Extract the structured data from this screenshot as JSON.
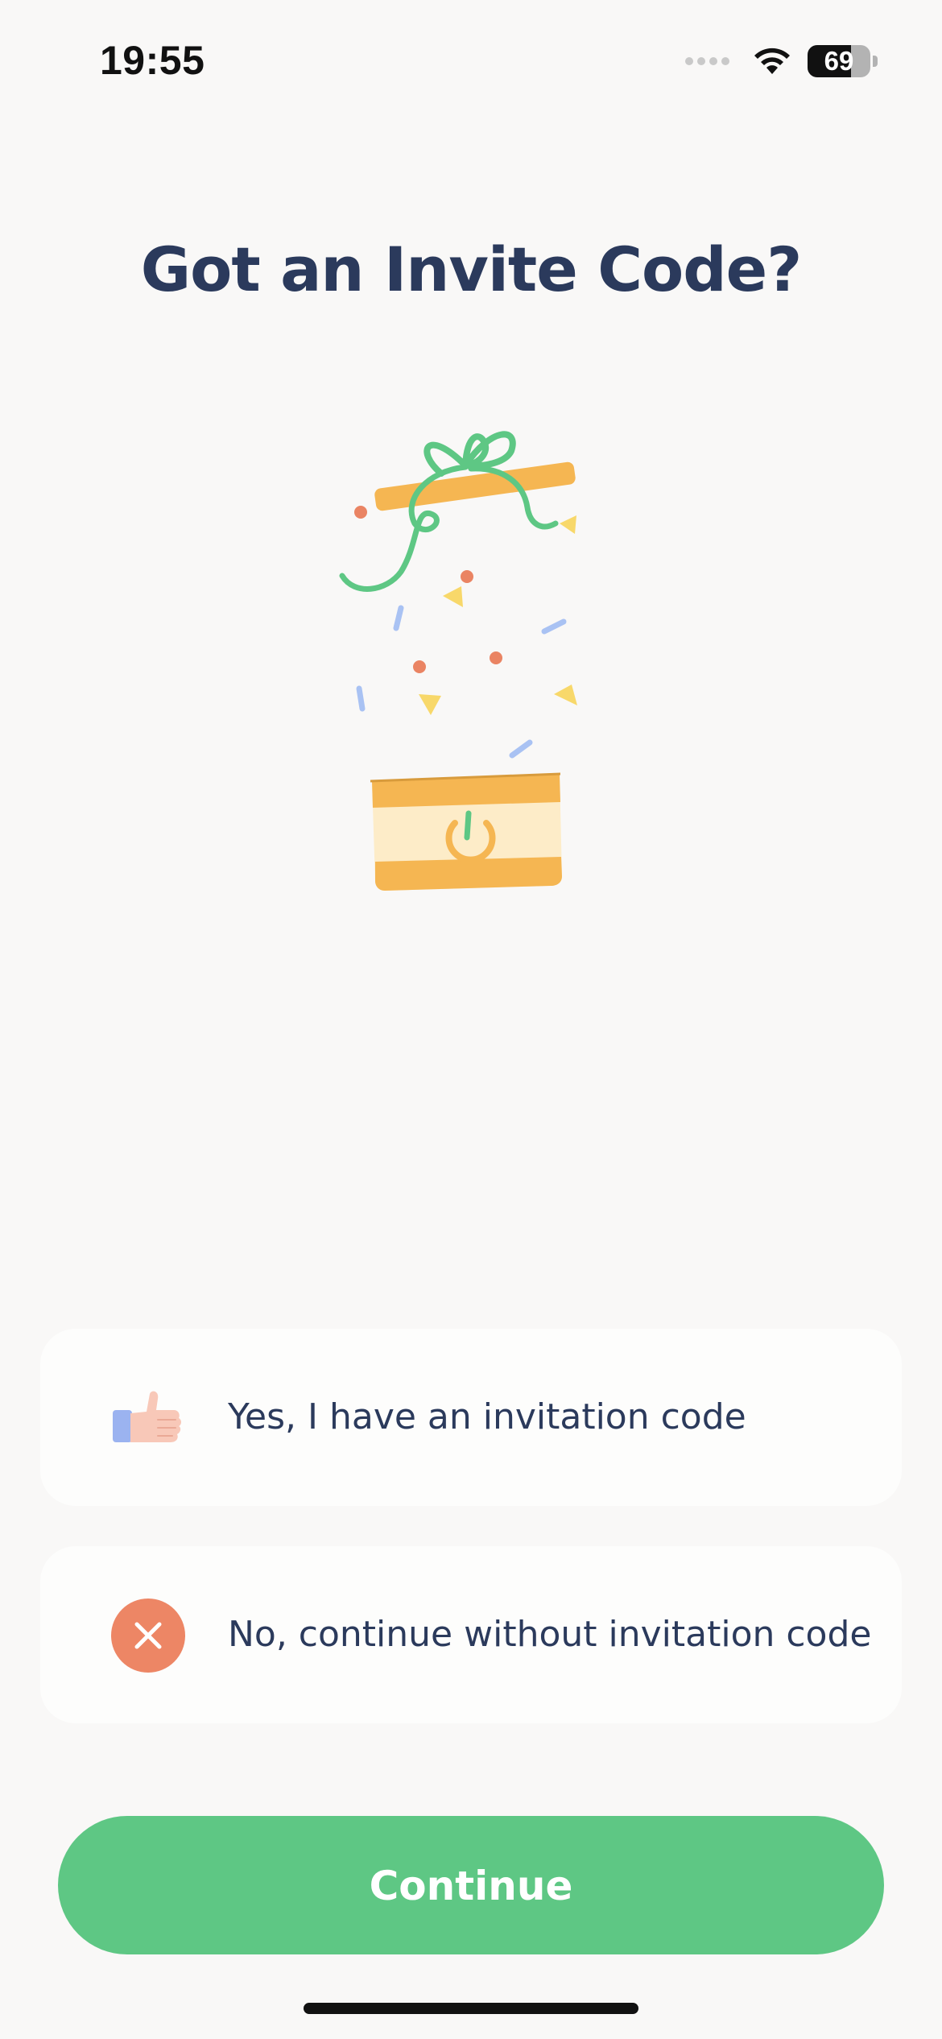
{
  "status_bar": {
    "time": "19:55",
    "battery_level": "69",
    "battery_fraction": 0.69,
    "icons": [
      "signal-dots-icon",
      "wifi-icon",
      "battery-icon"
    ]
  },
  "title": "Got an Invite Code?",
  "illustration": {
    "icon": "gift-box-confetti-illustration"
  },
  "options": [
    {
      "label": "Yes, I have an invitation code",
      "icon": "thumbs-up-icon"
    },
    {
      "label": "No, continue without invitation code",
      "icon": "close-circle-icon"
    }
  ],
  "continue_label": "Continue",
  "colors": {
    "background": "#f9f8f7",
    "title_text": "#2b3a5c",
    "accent_green": "#5ec784",
    "no_icon": "#ed8665",
    "gift_orange": "#f5b652",
    "gift_light": "#fdecc8",
    "confetti_blue": "#a9c2f3",
    "confetti_yellow": "#f8d86a",
    "confetti_red": "#ea8463"
  }
}
